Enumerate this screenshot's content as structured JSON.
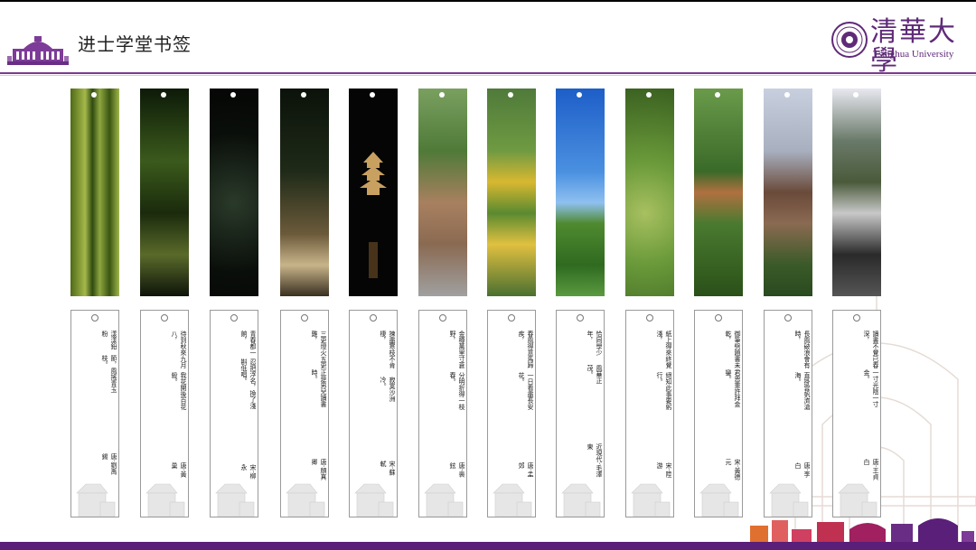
{
  "header": {
    "title": "进士学堂书签",
    "university_cn": "清華大學",
    "university_en": "Tsinghua University"
  },
  "colors": {
    "brand_purple": "#5f2a78",
    "rule_purple": "#7a3b8e"
  },
  "bookmarks": [
    {
      "scene": "bamboo",
      "line1": "漾漾鉛粉",
      "line2": "節，風搖青玉枝。",
      "author": "唐·劉禹錫"
    },
    {
      "scene": "night-bamboo",
      "line1": "待到秋來九月八，",
      "line2": "我花開後百花殺。",
      "author": "唐·黃巢"
    },
    {
      "scene": "night-lights",
      "line1": "青春都一餉，",
      "line2": "忍把浮名，換了淺斟低唱。",
      "author": "宋·柳永"
    },
    {
      "scene": "night-stairs",
      "line1": "三更燈火五更雞，",
      "line2": "正是男兒讀書時。",
      "author": "唐·顏真卿"
    },
    {
      "scene": "night-pagoda",
      "line1": "揀盡寒枝不肯棲，",
      "line2": "寂寞沙洲冷。",
      "author": "宋·蘇軾"
    },
    {
      "scene": "courtyard",
      "line1": "金樽萬里寸蒼野，",
      "line2": "分明折得一枝春。",
      "author": "唐·裴鉉"
    },
    {
      "scene": "sunflowers",
      "line1": "春風得意馬蹄疾，",
      "line2": "一日看盡長安花。",
      "author": "唐·孟郊"
    },
    {
      "scene": "blue-sky",
      "line1": "恰同學少年，",
      "line2": "風華正茂。",
      "author": "近現代·毛澤東"
    },
    {
      "scene": "grapes",
      "line1": "紙上得來終覺淺，",
      "line2": "絕知此事要躬行。",
      "author": "宋·陸游"
    },
    {
      "scene": "fruit-tree",
      "line1": "御筆劈題書未乾，",
      "line2": "君恩重許拜金鑾。",
      "author": "宋·黃德元"
    },
    {
      "scene": "rooftops",
      "line1": "長風破浪會有時，",
      "line2": "直掛雲帆濟滄海。",
      "author": "唐·李白"
    },
    {
      "scene": "old-house",
      "line1": "讀書不覺已春深，",
      "line2": "一寸光陰一寸金。",
      "author": "唐·王貞白"
    }
  ]
}
